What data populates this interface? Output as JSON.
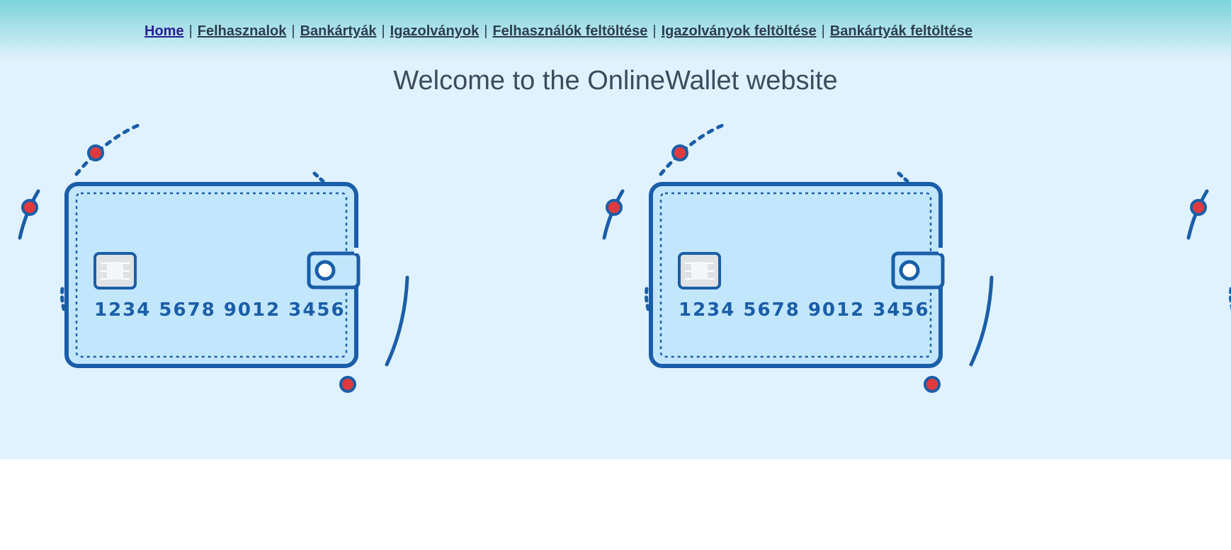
{
  "nav": {
    "items": [
      {
        "label": "Home",
        "current": true
      },
      {
        "label": "Felhasznalok"
      },
      {
        "label": "Bankártyák"
      },
      {
        "label": "Igazolványok"
      },
      {
        "label": "Felhasználók feltöltése"
      },
      {
        "label": "Igazolványok feltöltése"
      },
      {
        "label": "Bankártyák feltöltése"
      }
    ],
    "separator": "|"
  },
  "header": {
    "title": "Welcome to the OnlineWallet website"
  },
  "wallet_card": {
    "number": "1234 5678 9012 3456"
  },
  "icons": {
    "wallet": "wallet-card-icon",
    "chip": "card-chip-icon",
    "clasp": "wallet-clasp-icon",
    "dot": "red-dot-icon"
  },
  "colors": {
    "accent_blue": "#1a5ea8",
    "card_fill": "#c2e6fc",
    "dot_red": "#e03a3e",
    "background": "#e0f2fd"
  }
}
